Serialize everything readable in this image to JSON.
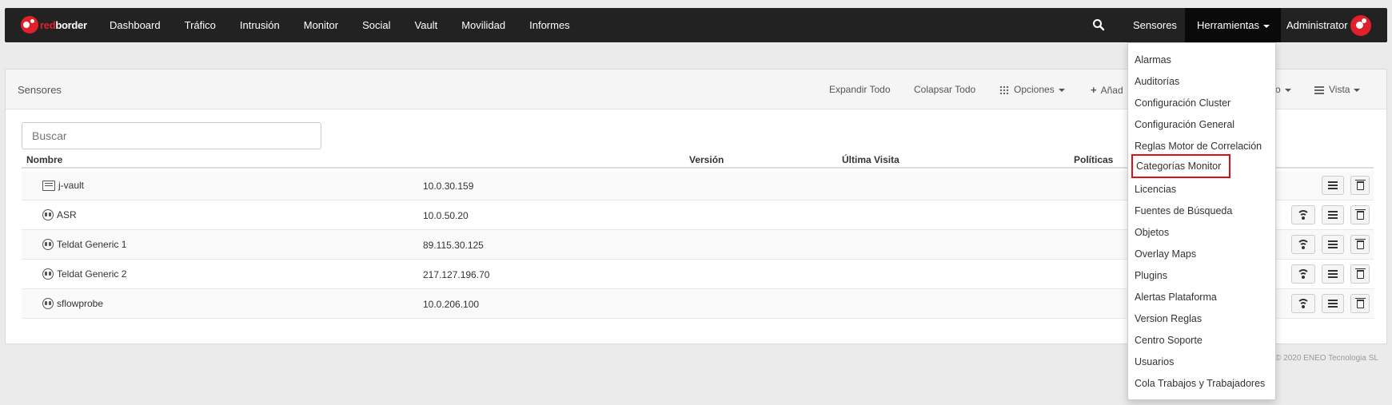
{
  "navbar": {
    "logo": {
      "part1": "red",
      "part2": "border"
    },
    "items": [
      "Dashboard",
      "Tráfico",
      "Intrusión",
      "Monitor",
      "Social",
      "Vault",
      "Movilidad",
      "Informes"
    ],
    "right": {
      "sensores": "Sensores",
      "herramientas": "Herramientas",
      "admin": "Administrator"
    }
  },
  "panel": {
    "title": "Sensores",
    "actions": {
      "expand": "Expandir Todo",
      "collapse": "Colapsar Todo",
      "options": "Opciones",
      "add": "Añad",
      "hidden_tail": "o",
      "view": "Vista"
    },
    "search_placeholder": "Buscar",
    "columns": {
      "name": "Nombre",
      "version": "Versión",
      "last_visit": "Última Visita",
      "policies": "Políticas"
    },
    "rows": [
      {
        "name": "j-vault",
        "ip": "10.0.30.159",
        "icon": "vault-icon"
      },
      {
        "name": "ASR",
        "ip": "10.0.50.20",
        "icon": "sensor-icon"
      },
      {
        "name": "Teldat Generic 1",
        "ip": "89.115.30.125",
        "icon": "sensor-icon"
      },
      {
        "name": "Teldat Generic 2",
        "ip": "217.127.196.70",
        "icon": "sensor-icon"
      },
      {
        "name": "sflowprobe",
        "ip": "10.0.206.100",
        "icon": "sensor-icon"
      }
    ]
  },
  "dropdown": {
    "items": [
      "Alarmas",
      "Auditorías",
      "Configuración Cluster",
      "Configuración General",
      "Reglas Motor de Correlación",
      "Categorías Monitor",
      "Licencias",
      "Fuentes de Búsqueda",
      "Objetos",
      "Overlay Maps",
      "Plugins",
      "Alertas Plataforma",
      "Version Reglas",
      "Centro Soporte",
      "Usuarios",
      "Cola Trabajos y Trabajadores"
    ],
    "highlighted": "Categorías Monitor"
  },
  "footer": "© 2020 ENEO Tecnologia SL",
  "colors": {
    "navbar": "#222222",
    "brand_red": "#e0202a",
    "highlight_border": "#e01010"
  }
}
